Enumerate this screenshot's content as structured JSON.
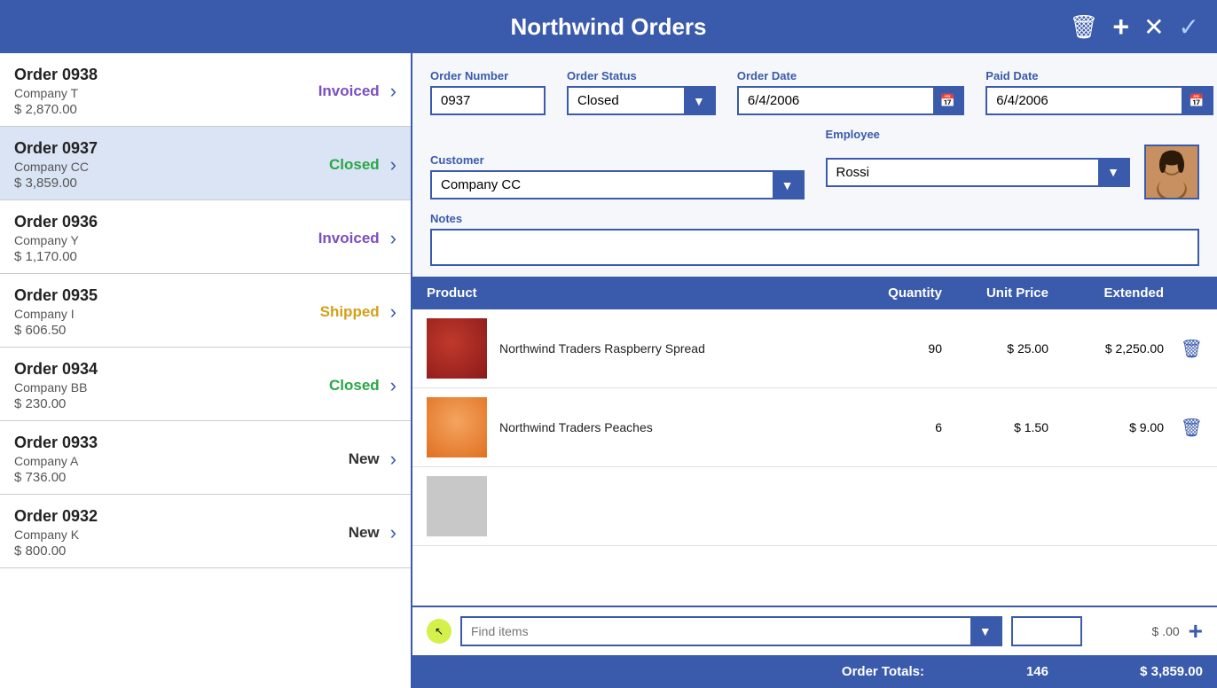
{
  "app": {
    "title": "Northwind Orders"
  },
  "header": {
    "title": "Northwind Orders",
    "delete_icon": "🗑",
    "add_icon": "+",
    "cancel_icon": "✕",
    "confirm_icon": "✓"
  },
  "orders": [
    {
      "id": "0938",
      "name": "Order 0938",
      "company": "Company T",
      "amount": "$ 2,870.00",
      "status": "Invoiced",
      "status_class": "status-invoiced"
    },
    {
      "id": "0937",
      "name": "Order 0937",
      "company": "Company CC",
      "amount": "$ 3,859.00",
      "status": "Closed",
      "status_class": "status-closed",
      "selected": true
    },
    {
      "id": "0936",
      "name": "Order 0936",
      "company": "Company Y",
      "amount": "$ 1,170.00",
      "status": "Invoiced",
      "status_class": "status-invoiced"
    },
    {
      "id": "0935",
      "name": "Order 0935",
      "company": "Company I",
      "amount": "$ 606.50",
      "status": "Shipped",
      "status_class": "status-shipped"
    },
    {
      "id": "0934",
      "name": "Order 0934",
      "company": "Company BB",
      "amount": "$ 230.00",
      "status": "Closed",
      "status_class": "status-closed"
    },
    {
      "id": "0933",
      "name": "Order 0933",
      "company": "Company A",
      "amount": "$ 736.00",
      "status": "New",
      "status_class": "status-new"
    },
    {
      "id": "0932",
      "name": "Order 0932",
      "company": "Company K",
      "amount": "$ 800.00",
      "status": "New",
      "status_class": "status-new"
    }
  ],
  "detail": {
    "order_number_label": "Order Number",
    "order_number_value": "0937",
    "order_status_label": "Order Status",
    "order_status_value": "Closed",
    "order_date_label": "Order Date",
    "order_date_value": "6/4/2006",
    "paid_date_label": "Paid Date",
    "paid_date_value": "6/4/2006",
    "customer_label": "Customer",
    "customer_value": "Company CC",
    "employee_label": "Employee",
    "employee_value": "Rossi",
    "notes_label": "Notes",
    "notes_value": ""
  },
  "products_table": {
    "col_product": "Product",
    "col_quantity": "Quantity",
    "col_unit_price": "Unit Price",
    "col_extended": "Extended"
  },
  "products": [
    {
      "name": "Northwind Traders Raspberry Spread",
      "quantity": "90",
      "unit_price": "$ 25.00",
      "extended": "$ 2,250.00",
      "thumb": "raspberry"
    },
    {
      "name": "Northwind Traders Peaches",
      "quantity": "6",
      "unit_price": "$ 1.50",
      "extended": "$ 9.00",
      "thumb": "peaches"
    }
  ],
  "add_row": {
    "placeholder": "Find items",
    "amount": "$ .00",
    "add_btn": "+"
  },
  "totals": {
    "label": "Order Totals:",
    "quantity": "146",
    "extended": "$ 3,859.00"
  }
}
